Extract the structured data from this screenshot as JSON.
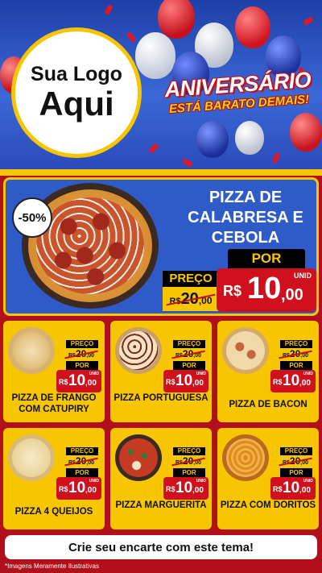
{
  "header": {
    "logo_line1": "Sua Logo",
    "logo_line2": "Aqui",
    "anniversary_title": "ANIVERSÁRIO",
    "anniversary_subtitle": "ESTÁ BARATO DEMAIS!"
  },
  "featured": {
    "discount_badge": "-50%",
    "title": "PIZZA DE CALABRESA E CEBOLA",
    "preco_label": "PREÇO",
    "old_currency": "R$",
    "old_int": "20",
    "old_cents": ",00",
    "por_label": "POR",
    "unid_label": "UNID",
    "new_currency": "R$",
    "new_int": "10",
    "new_cents": ",00"
  },
  "products": [
    {
      "name": "PIZZA DE FRANGO COM CATUPIRY",
      "preco_label": "PREÇO",
      "old_currency": "R$",
      "old_int": "20",
      "old_cents": ",00",
      "por_label": "POR",
      "unid_label": "UNID",
      "new_currency": "R$",
      "new_int": "10",
      "new_cents": ",00"
    },
    {
      "name": "PIZZA PORTUGUESA",
      "preco_label": "PREÇO",
      "old_currency": "R$",
      "old_int": "20",
      "old_cents": ",00",
      "por_label": "POR",
      "unid_label": "UNID",
      "new_currency": "R$",
      "new_int": "10",
      "new_cents": ",00"
    },
    {
      "name": "PIZZA DE BACON",
      "preco_label": "PREÇO",
      "old_currency": "R$",
      "old_int": "20",
      "old_cents": ",00",
      "por_label": "POR",
      "unid_label": "UNID",
      "new_currency": "R$",
      "new_int": "10",
      "new_cents": ",00"
    },
    {
      "name": "PIZZA 4 QUEIJOS",
      "preco_label": "PREÇO",
      "old_currency": "R$",
      "old_int": "20",
      "old_cents": ",00",
      "por_label": "POR",
      "unid_label": "UNID",
      "new_currency": "R$",
      "new_int": "10",
      "new_cents": ",00"
    },
    {
      "name": "PIZZA MARGUERITA",
      "preco_label": "PREÇO",
      "old_currency": "R$",
      "old_int": "20",
      "old_cents": ",00",
      "por_label": "POR",
      "unid_label": "UNID",
      "new_currency": "R$",
      "new_int": "10",
      "new_cents": ",00"
    },
    {
      "name": "PIZZA COM DORITOS",
      "preco_label": "PREÇO",
      "old_currency": "R$",
      "old_int": "20",
      "old_cents": ",00",
      "por_label": "POR",
      "unid_label": "UNID",
      "new_currency": "R$",
      "new_int": "10",
      "new_cents": ",00"
    }
  ],
  "footer": {
    "cta": "Crie seu encarte com este tema!",
    "disclaimer": "*Imagens Meramente Ilustrativas"
  },
  "colors": {
    "brand_red": "#d0101c",
    "brand_yellow": "#f7c600",
    "header_blue": "#2f5bc9"
  }
}
